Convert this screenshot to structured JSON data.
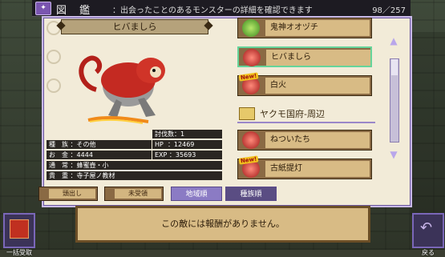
{
  "header": {
    "book_icon": "book-icon",
    "title": "図 鑑",
    "hint": "：出会ったことのあるモンスターの詳細を確認できます",
    "count": "98／257"
  },
  "monster": {
    "name": "ヒバましら",
    "kill_label": "討伐数：",
    "kill_value": "1",
    "hp_label": "HP",
    "hp_value": "：12469",
    "exp_label": "EXP",
    "exp_value": "：35693",
    "type_label": "種　族",
    "type_value": "：その他",
    "gold_label": "お　金",
    "gold_value": "：4444",
    "normal_label": "通　常",
    "normal_value": "：蜂蜜壺・小",
    "rare_label": "貴　重",
    "rare_value": "：寺子屋ノ教材"
  },
  "list": {
    "entries": [
      {
        "label": "鬼神オオヅチ",
        "icon": "green-orb-icon",
        "new": ""
      },
      {
        "label": "ヒバましら",
        "icon": "red-orb-icon",
        "new": ""
      },
      {
        "label": "白火",
        "icon": "red-orb-icon",
        "new": "New!"
      },
      {
        "label": "ねついたち",
        "icon": "red-orb-icon",
        "new": ""
      },
      {
        "label": "古紙提灯",
        "icon": "red-orb-icon",
        "new": "New!"
      }
    ],
    "region": "ヤクモ国府-周辺"
  },
  "tabs": {
    "head": "頭出し",
    "unreceived": "未受領",
    "by_region": "地域順",
    "by_species": "種族順"
  },
  "message": "この敵には報酬がありません。",
  "buttons": {
    "collect_all": "一括受取",
    "back": "戻る"
  },
  "colors": {
    "panel_bg": "#f2ebd8",
    "entry_plate": "#d8bb85",
    "accent_purple": "#8b7bc4"
  }
}
